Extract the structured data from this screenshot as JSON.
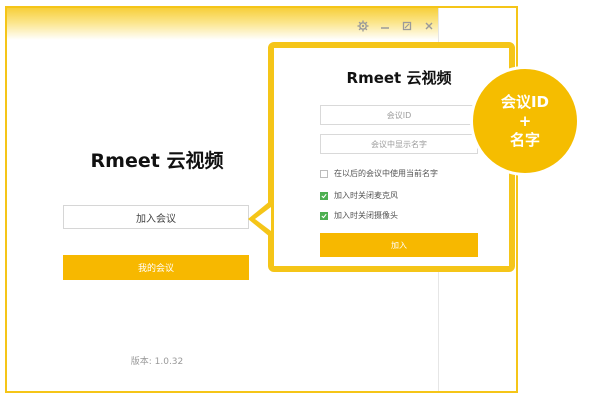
{
  "window": {
    "controls": {
      "settings_icon": "gear-icon",
      "minimize_icon": "minimize-icon",
      "maximize_icon": "maximize-icon",
      "close_icon": "close-icon"
    }
  },
  "main": {
    "title": "Rmeet 云视频",
    "join_input_label": "加入会议",
    "my_meetings_label": "我的会议",
    "version": "版本: 1.0.32"
  },
  "popup": {
    "title": "Rmeet 云视频",
    "meeting_id_placeholder": "会议ID",
    "display_name_placeholder": "会议中显示名字",
    "options": [
      {
        "label": "在以后的会议中使用当前名字",
        "checked": false
      },
      {
        "label": "加入时关闭麦克风",
        "checked": true
      },
      {
        "label": "加入时关闭摄像头",
        "checked": true
      }
    ],
    "join_label": "加入"
  },
  "callout": {
    "line1": "会议ID",
    "line2": "+",
    "line3": "名字"
  },
  "colors": {
    "accent": "#f7b800",
    "frame": "#f5c518",
    "check": "#4caf50"
  }
}
